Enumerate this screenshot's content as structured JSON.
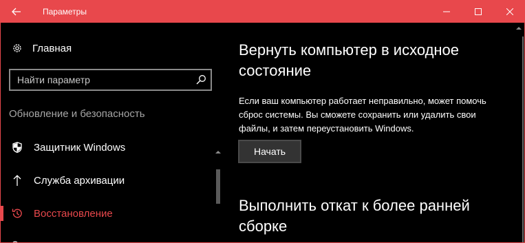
{
  "window": {
    "title": "Параметры",
    "accent_color": "#e8484c"
  },
  "sidebar": {
    "home_label": "Главная",
    "search": {
      "placeholder": "Найти параметр"
    },
    "section_header": "Обновление и безопасность",
    "items": [
      {
        "label": "Защитник Windows",
        "icon": "shield-icon",
        "active": false
      },
      {
        "label": "Служба архивации",
        "icon": "upload-arrow-icon",
        "active": false
      },
      {
        "label": "Восстановление",
        "icon": "history-icon",
        "active": true
      }
    ]
  },
  "main": {
    "reset_section": {
      "title": "Вернуть компьютер в исходное состояние",
      "description": "Если ваш компьютер работает неправильно, может помочь сброс системы. Вы сможете сохранить или удалить свои файлы, и затем переустановить Windows.",
      "button_label": "Начать"
    },
    "rollback_section": {
      "title": "Выполнить откат к более ранней сборке"
    }
  }
}
